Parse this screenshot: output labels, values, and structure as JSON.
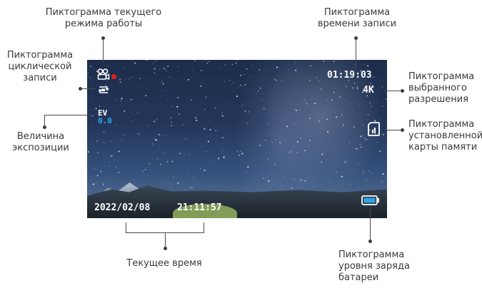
{
  "labels": {
    "mode": "Пиктограмма текущего режима работы",
    "record_time": "Пиктограмма времени записи",
    "loop": "Пиктограмма циклической записи",
    "resolution": "Пиктограмма выбранного разрешения",
    "exposure": "Величина экспозиции",
    "sdcard": "Пиктограмма установленной карты памяти",
    "current_time": "Текущее время",
    "battery": "Пиктограмма уровня заряда батареи"
  },
  "screen": {
    "record_time": "01:19:03",
    "resolution": "4K",
    "ev_label": "EV",
    "ev_value": "0.0",
    "date": "2022/02/08",
    "time": "21:11:57"
  },
  "icons": [
    "video-mode-icon",
    "loop-recording-icon",
    "sd-card-icon",
    "battery-icon",
    "record-dot-icon"
  ],
  "colors": {
    "ev_value": "#2fa4e7",
    "record_dot": "#e02020",
    "battery": "#2fa4e7"
  }
}
